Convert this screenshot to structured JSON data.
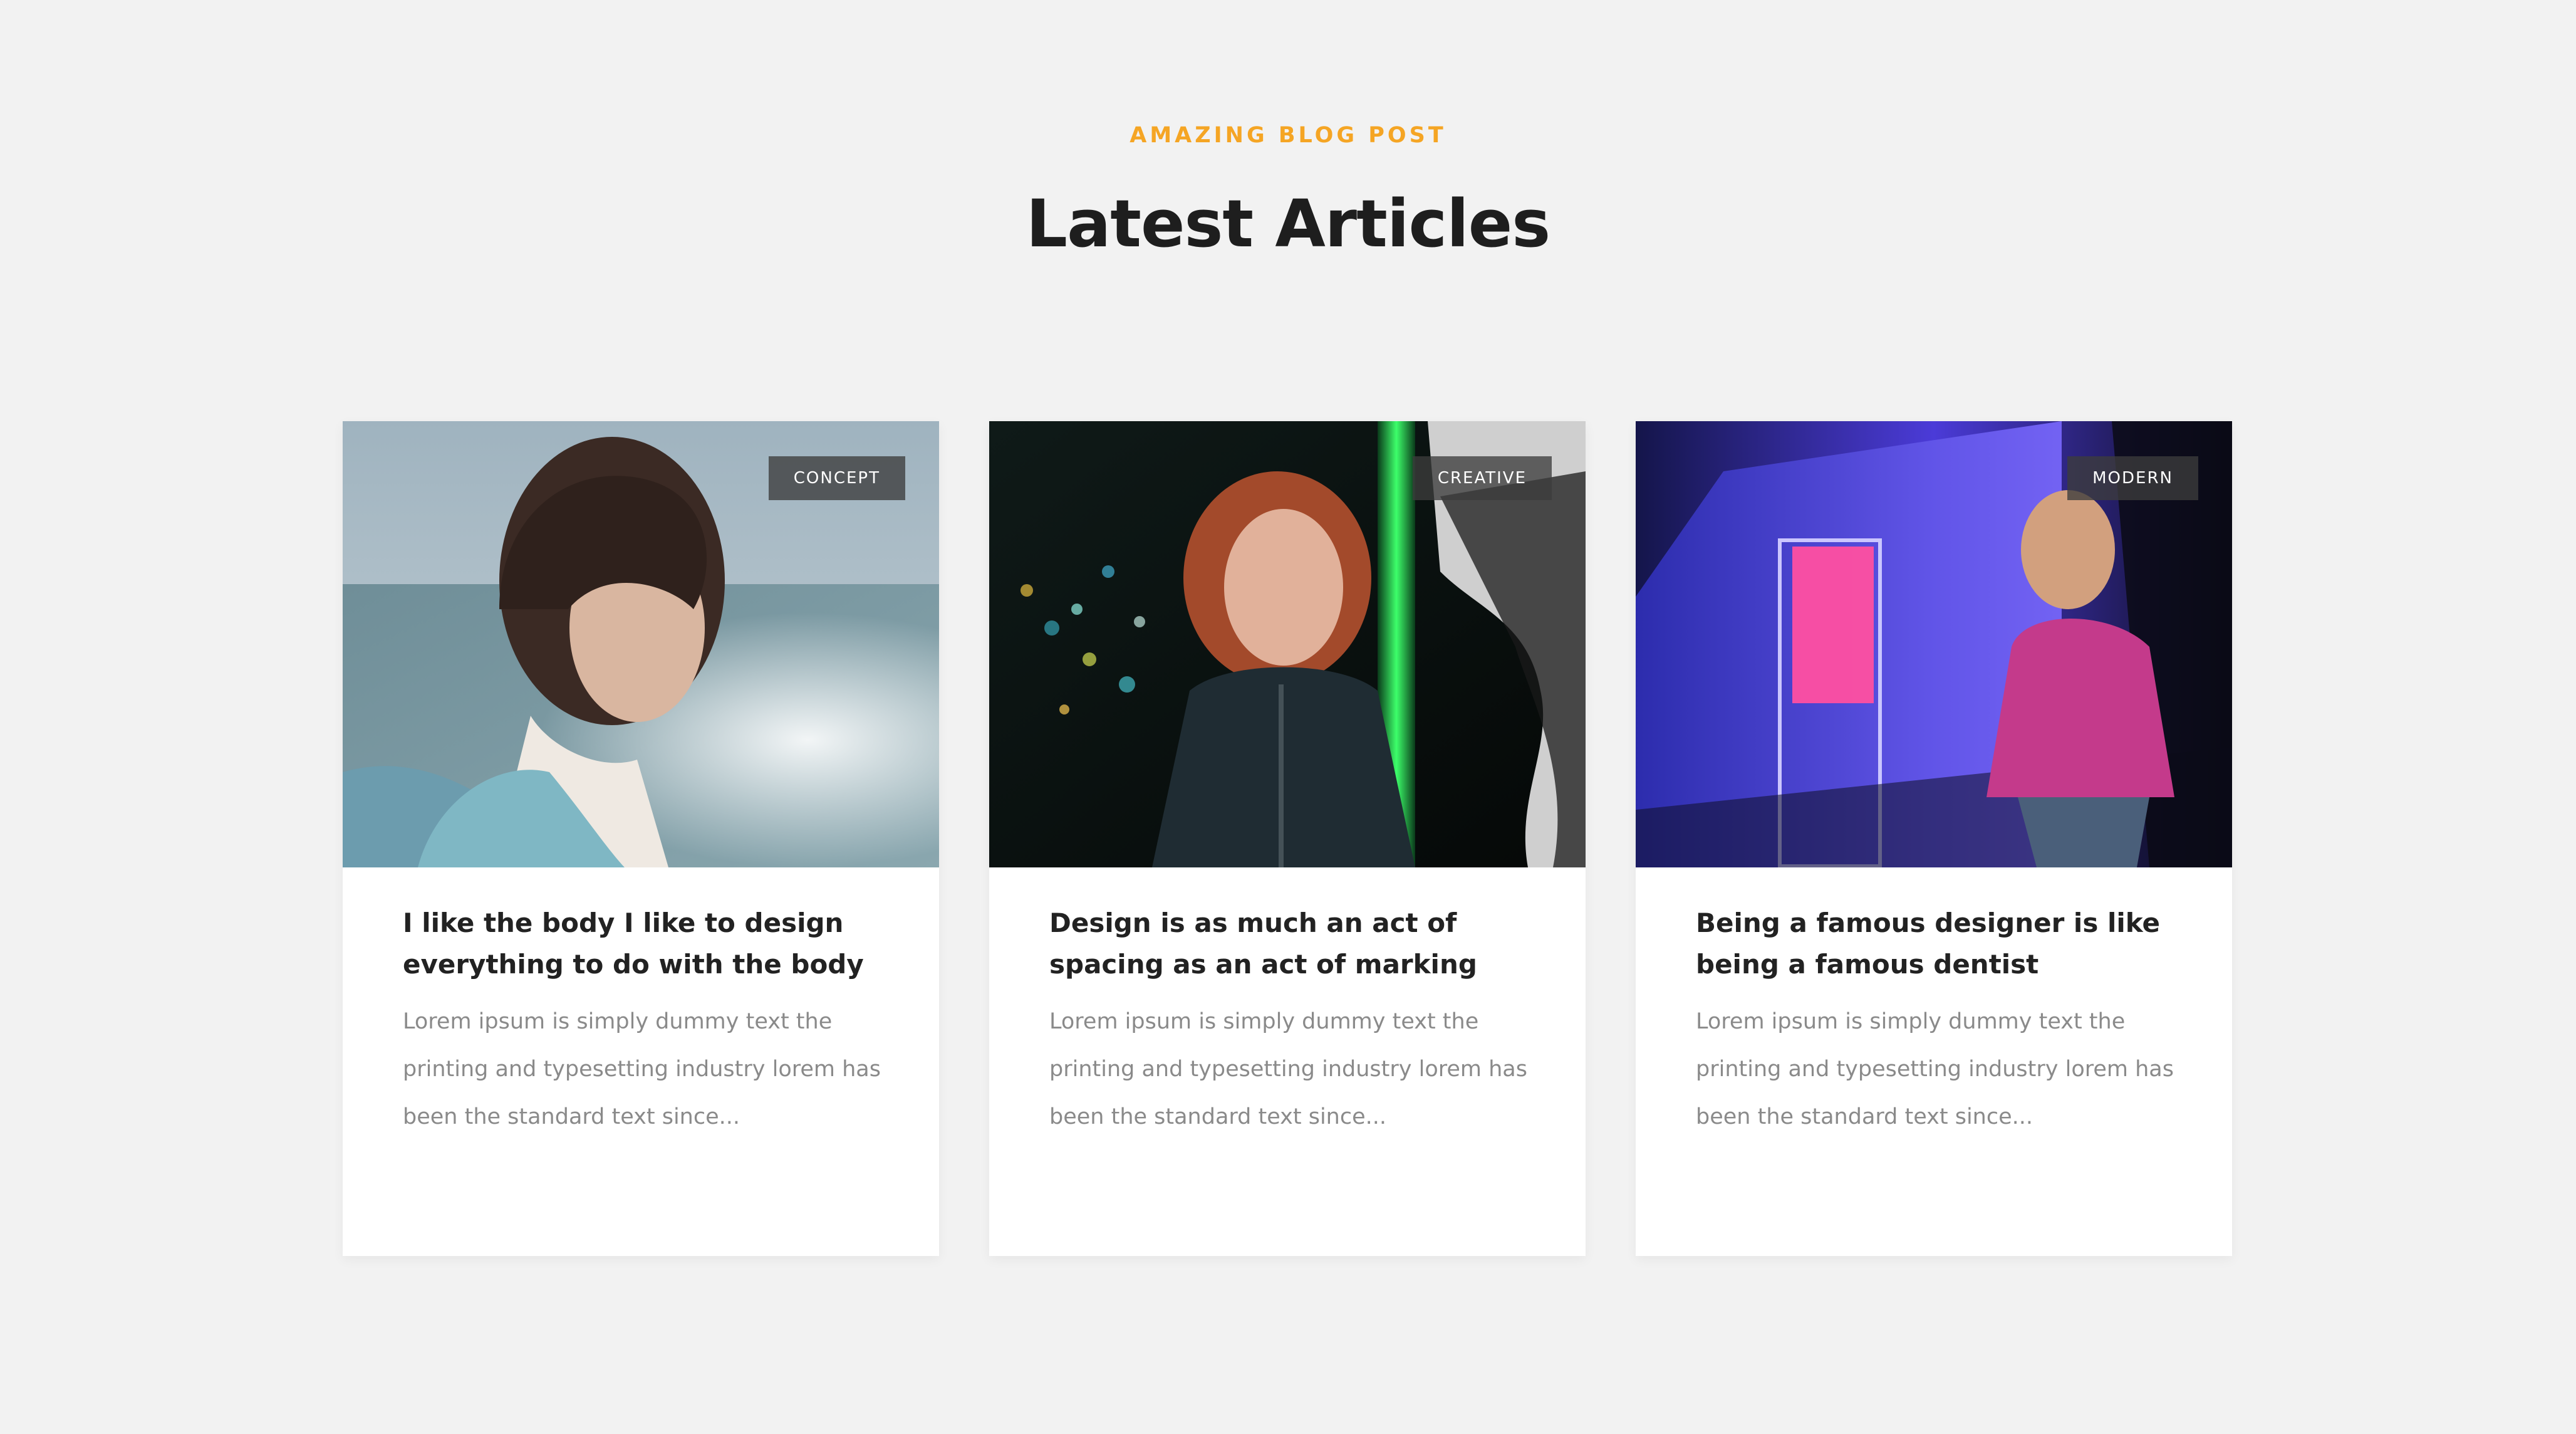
{
  "section": {
    "eyebrow": "AMAZING BLOG POST",
    "title": "Latest Articles"
  },
  "colors": {
    "accent": "#f5a524",
    "background": "#f2f2f2",
    "card": "#ffffff",
    "tag_background": "#3c3c3c"
  },
  "articles": [
    {
      "tag": "CONCEPT",
      "title": "I like the body I like to design everything to do with the body",
      "excerpt": "Lorem ipsum is simply dummy text the printing and typesetting industry lorem has been the standard text since...",
      "image": "woman-by-sea-photo"
    },
    {
      "tag": "CREATIVE",
      "title": "Design is as much an act of spacing as an act of marking",
      "excerpt": "Lorem ipsum is simply dummy text the printing and typesetting industry lorem has been the standard text since...",
      "image": "woman-neon-night-photo"
    },
    {
      "tag": "MODERN",
      "title": "Being a famous designer is like being a famous dentist",
      "excerpt": "Lorem ipsum is simply dummy text the printing and typesetting industry lorem has been the standard text since...",
      "image": "woman-purple-wall-photo"
    }
  ]
}
